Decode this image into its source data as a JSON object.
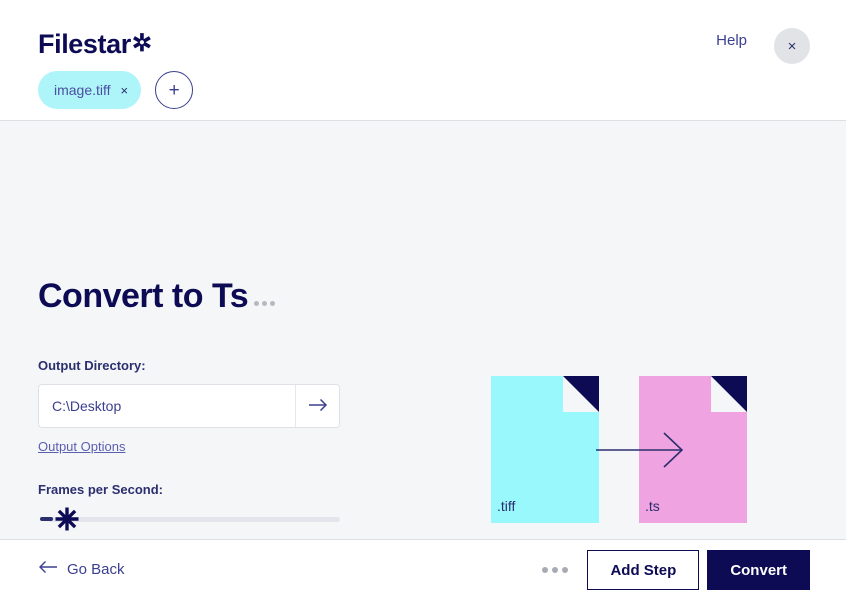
{
  "header": {
    "brand": "Filestar",
    "brand_star": "✲",
    "help_label": "Help",
    "close_icon": "×",
    "files": [
      {
        "name": "image.tiff",
        "close_icon": "×"
      }
    ],
    "add_file_icon": "+"
  },
  "main": {
    "title": "Convert to Ts",
    "title_more_icon": "ellipsis-icon",
    "output_directory": {
      "label": "Output Directory:",
      "value": "C:\\Desktop",
      "placeholder": "C:\\Desktop",
      "go_icon": "arrow-right-icon"
    },
    "output_options_label": "Output Options",
    "frames_per_second": {
      "label": "Frames per Second:",
      "value": 0,
      "min": 0,
      "max": 100,
      "thumb_icon": "asterisk-icon",
      "decrement_icon": "minus-icon"
    },
    "illustration": {
      "source": {
        "ext": ".tiff",
        "color": "#99f8fc"
      },
      "target": {
        "ext": ".ts",
        "color": "#efa3e0"
      },
      "arrow_icon": "arrow-right-icon",
      "fold_color": "#0d0b54"
    }
  },
  "footer": {
    "go_back_label": "Go Back",
    "go_back_icon": "arrow-left-icon",
    "more_icon": "ellipsis-icon",
    "add_step_label": "Add Step",
    "convert_label": "Convert"
  },
  "colors": {
    "navy": "#0d0b54",
    "indigo": "#3b3f8f",
    "chip_cyan": "#aef5f9",
    "file_cyan": "#99f8fc",
    "file_pink": "#efa3e0",
    "page_bg": "#f5f6f8"
  }
}
